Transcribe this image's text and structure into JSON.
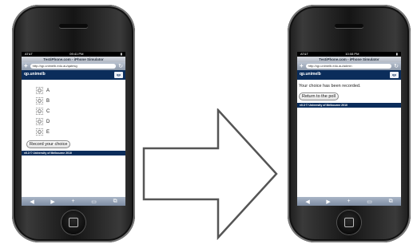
{
  "before": {
    "status": {
      "carrier": "AT&T",
      "time": "09:41 PM"
    },
    "window_title": "TestiPhone.com - iPhone Simulator",
    "url": "http://qp.unimelb.edu.au/qatesg",
    "site_name": "qp.unimelb",
    "logo_text": "qp",
    "logo_subtext": "QUIZ POLL",
    "options": [
      "A",
      "B",
      "C",
      "D",
      "E"
    ],
    "submit_label": "Record your choice",
    "footer": "v0.3 © University of Melbourne 2010"
  },
  "after": {
    "status": {
      "carrier": "AT&T",
      "time": "10:08 PM"
    },
    "window_title": "TestiPhone.com - iPhone Simulator",
    "url": "http://qp.unimelb.edu.au/admin",
    "site_name": "qp.unimelb",
    "logo_text": "qp",
    "logo_subtext": "QUIZ POLL",
    "message": "Your choice has been recorded.",
    "return_label": "Return to the poll",
    "footer": "v0.3 © University of Melbourne 2010"
  },
  "toolbar_icons": [
    "back-arrow-icon",
    "forward-arrow-icon",
    "add-icon",
    "bookmarks-icon",
    "pages-icon"
  ],
  "colors": {
    "header": "#0b2d5b",
    "phone_body": "#1a1a1a",
    "toolbar": "#8e9aab"
  }
}
